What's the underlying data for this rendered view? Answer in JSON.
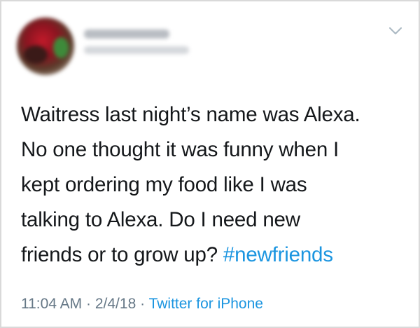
{
  "tweet": {
    "author": {
      "avatar_icon": "avatar-image",
      "name_blurred": true,
      "handle_blurred": true
    },
    "menu_icon": "chevron-down-icon",
    "text_lines": [
      "Waitress last night’s name was Alexa.",
      "No one thought it was funny when I",
      "kept ordering my food like I was",
      "talking to Alexa. Do I need new",
      "friends or to grow up? "
    ],
    "hashtag": "#newfriends",
    "time": "11:04 AM",
    "separator": "·",
    "date": "2/4/18",
    "source": "Twitter for iPhone"
  },
  "colors": {
    "text": "#14171a",
    "link": "#1b95e0",
    "meta": "#657786",
    "border": "#d9d9d9"
  }
}
